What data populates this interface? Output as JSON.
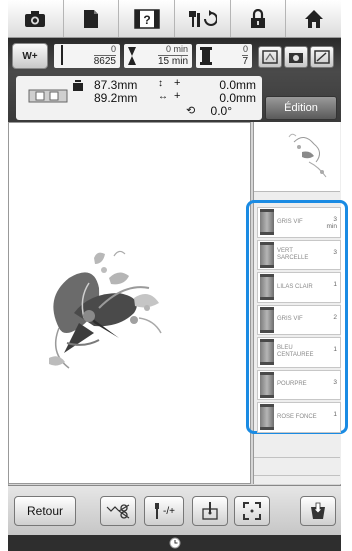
{
  "topbar": {
    "items": [
      {
        "icon": "camera-icon"
      },
      {
        "icon": "document-icon"
      },
      {
        "icon": "help-book-icon",
        "label": "[?]"
      },
      {
        "icon": "needle-refresh-icon"
      },
      {
        "icon": "lock-icon"
      },
      {
        "icon": "home-icon"
      }
    ]
  },
  "status": {
    "w_button": "W+",
    "stitch_count": {
      "top": "0",
      "bottom": "8625"
    },
    "time": {
      "top": "0 min",
      "bottom": "15 min"
    },
    "color_count": {
      "top": "0",
      "bottom": "7"
    },
    "size": {
      "height": "87.3mm",
      "width": "89.2mm"
    },
    "offset": {
      "y": "0.0mm",
      "x": "0.0mm"
    },
    "angle": "0.0°",
    "edit_label": "Édition"
  },
  "threads": [
    {
      "name": "GRIS VIF",
      "count": "3",
      "unit": "min"
    },
    {
      "name": "VERT SARCELLE",
      "count": "3",
      "unit": ""
    },
    {
      "name": "LILAS CLAIR",
      "count": "1",
      "unit": ""
    },
    {
      "name": "GRIS VIF",
      "count": "2",
      "unit": ""
    },
    {
      "name": "BLEU CENTAUREE",
      "count": "1",
      "unit": ""
    },
    {
      "name": "POURPRE",
      "count": "3",
      "unit": ""
    },
    {
      "name": "ROSE FONCE",
      "count": "1",
      "unit": ""
    }
  ],
  "bottom": {
    "back_label": "Retour",
    "adjust_label": "-/+"
  },
  "colors": {
    "highlight": "#1a8be3",
    "status_bg": "#3a3a3a"
  }
}
